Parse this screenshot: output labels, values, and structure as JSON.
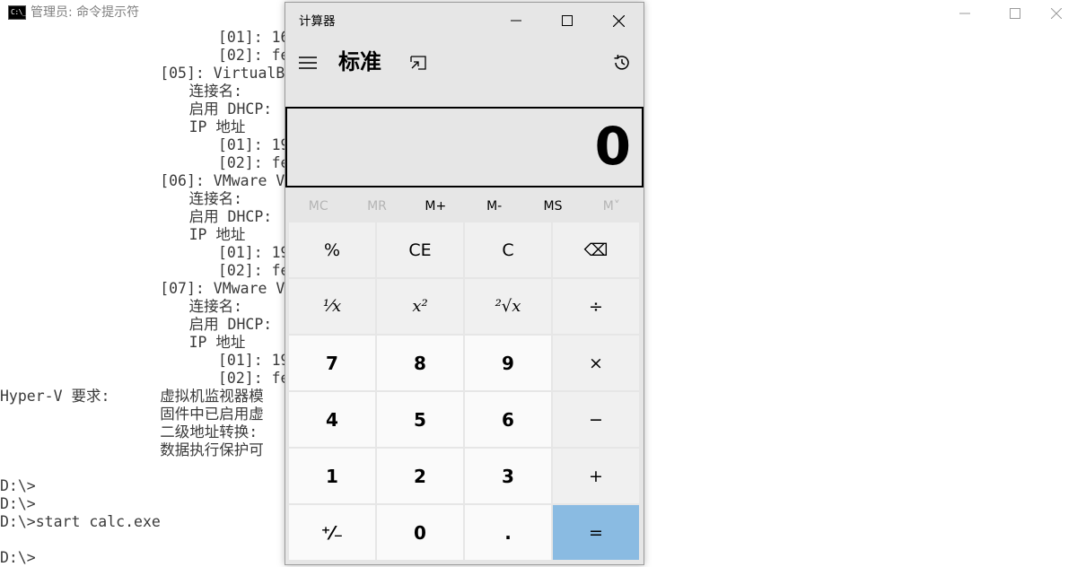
{
  "console": {
    "title": "管理员: 命令提示符",
    "lines": [
      {
        "indent": 30,
        "text": "[01]: 16"
      },
      {
        "indent": 30,
        "text": "[02]: fe"
      },
      {
        "indent": 22,
        "text": "[05]: VirtualB"
      },
      {
        "indent": 26,
        "text": "连接名:"
      },
      {
        "indent": 26,
        "text": "启用 DHCP:"
      },
      {
        "indent": 26,
        "text": "IP 地址"
      },
      {
        "indent": 30,
        "text": "[01]: 19"
      },
      {
        "indent": 30,
        "text": "[02]: fe"
      },
      {
        "indent": 22,
        "text": "[06]: VMware V"
      },
      {
        "indent": 26,
        "text": "连接名:"
      },
      {
        "indent": 26,
        "text": "启用 DHCP:"
      },
      {
        "indent": 26,
        "text": "IP 地址"
      },
      {
        "indent": 30,
        "text": "[01]: 19"
      },
      {
        "indent": 30,
        "text": "[02]: fe"
      },
      {
        "indent": 22,
        "text": "[07]: VMware V"
      },
      {
        "indent": 26,
        "text": "连接名:"
      },
      {
        "indent": 26,
        "text": "启用 DHCP:"
      },
      {
        "indent": 26,
        "text": "IP 地址"
      },
      {
        "indent": 30,
        "text": "[01]: 19"
      },
      {
        "indent": 30,
        "text": "[02]: fe"
      },
      {
        "indent": 0,
        "text": "Hyper-V 要求:",
        "text2": "虚拟机监视器模"
      },
      {
        "indent": 22,
        "text": "固件中已启用虚"
      },
      {
        "indent": 22,
        "text": "二级地址转换:"
      },
      {
        "indent": 22,
        "text": "数据执行保护可"
      },
      {
        "indent": 0,
        "text": ""
      },
      {
        "indent": 0,
        "text": "D:\\>"
      },
      {
        "indent": 0,
        "text": "D:\\>"
      },
      {
        "indent": 0,
        "text": "D:\\>start calc.exe"
      },
      {
        "indent": 0,
        "text": ""
      },
      {
        "indent": 0,
        "text": "D:\\>"
      }
    ]
  },
  "calculator": {
    "title": "计算器",
    "mode": "标准",
    "display": "0",
    "memory": [
      {
        "label": "MC",
        "enabled": false
      },
      {
        "label": "MR",
        "enabled": false
      },
      {
        "label": "M+",
        "enabled": true
      },
      {
        "label": "M-",
        "enabled": true
      },
      {
        "label": "MS",
        "enabled": true
      },
      {
        "label": "M˅",
        "enabled": false
      }
    ],
    "keys": [
      {
        "label": "%",
        "kind": "op",
        "name": "percent-button"
      },
      {
        "label": "CE",
        "kind": "op",
        "name": "clear-entry-button"
      },
      {
        "label": "C",
        "kind": "op",
        "name": "clear-button"
      },
      {
        "label": "⌫",
        "kind": "op",
        "name": "backspace-button"
      },
      {
        "label": "¹⁄x",
        "kind": "math",
        "name": "reciprocal-button"
      },
      {
        "label": "x²",
        "kind": "math",
        "name": "square-button"
      },
      {
        "label": "²√x",
        "kind": "math",
        "name": "square-root-button"
      },
      {
        "label": "÷",
        "kind": "op",
        "name": "divide-button"
      },
      {
        "label": "7",
        "kind": "digit",
        "name": "digit-7-button"
      },
      {
        "label": "8",
        "kind": "digit",
        "name": "digit-8-button"
      },
      {
        "label": "9",
        "kind": "digit",
        "name": "digit-9-button"
      },
      {
        "label": "×",
        "kind": "op",
        "name": "multiply-button"
      },
      {
        "label": "4",
        "kind": "digit",
        "name": "digit-4-button"
      },
      {
        "label": "5",
        "kind": "digit",
        "name": "digit-5-button"
      },
      {
        "label": "6",
        "kind": "digit",
        "name": "digit-6-button"
      },
      {
        "label": "−",
        "kind": "op",
        "name": "minus-button"
      },
      {
        "label": "1",
        "kind": "digit",
        "name": "digit-1-button"
      },
      {
        "label": "2",
        "kind": "digit",
        "name": "digit-2-button"
      },
      {
        "label": "3",
        "kind": "digit",
        "name": "digit-3-button"
      },
      {
        "label": "+",
        "kind": "op",
        "name": "plus-button"
      },
      {
        "label": "⁺⁄₋",
        "kind": "digit",
        "name": "negate-button"
      },
      {
        "label": "0",
        "kind": "digit",
        "name": "digit-0-button"
      },
      {
        "label": ".",
        "kind": "digit",
        "name": "decimal-button"
      },
      {
        "label": "=",
        "kind": "equals",
        "name": "equals-button"
      }
    ],
    "colors": {
      "equals": "#8abbe2",
      "window": "#e6e6e6"
    }
  }
}
